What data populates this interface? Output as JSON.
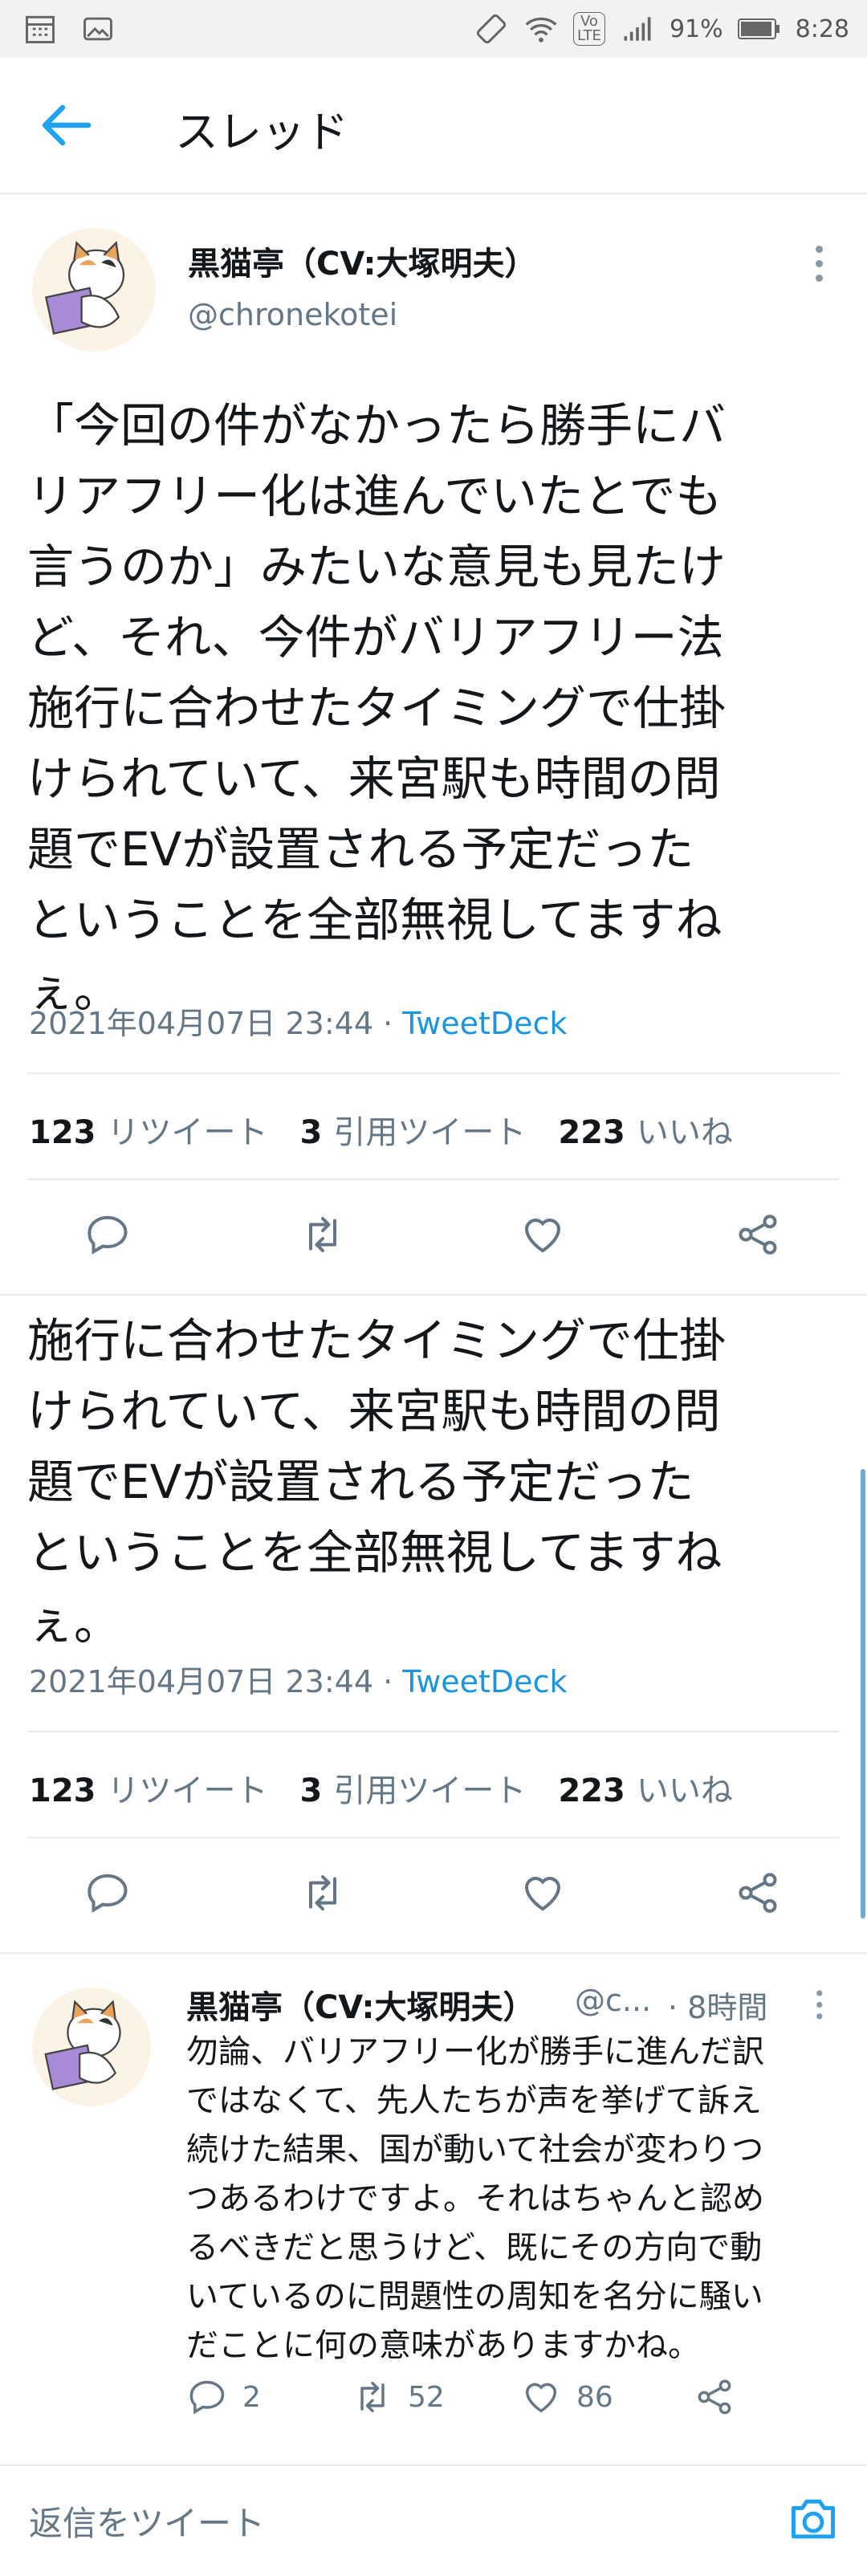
{
  "status_bar": {
    "battery": "91%",
    "time": "8:28",
    "lte": "LTE",
    "volte": "Vo"
  },
  "header": {
    "title": "スレッド"
  },
  "tweet": {
    "name": "黒猫亭（CV:大塚明夫）",
    "handle": "@chronekotei",
    "text": "「今回の件がなかったら勝手にバ\nリアフリー化は進んでいたとでも\n言うのか」みたいな意見も見たけ\nど、それ、今件がバリアフリー法\n施行に合わせたタイミングで仕掛\nけられていて、来宮駅も時間の問\n題でEVが設置される予定だった\nということを全部無視してますね\nぇ。",
    "date": "2021年04月07日 23:44",
    "separator": " · ",
    "client": "TweetDeck",
    "stats": [
      {
        "count": "123",
        "label": "リツイート"
      },
      {
        "count": "3",
        "label": "引用ツイート"
      },
      {
        "count": "223",
        "label": "いいね"
      }
    ]
  },
  "tweet_repeat": {
    "text": "施行に合わせたタイミングで仕掛\nけられていて、来宮駅も時間の問\n題でEVが設置される予定だった\nということを全部無視してますね\nぇ。",
    "date": "2021年04月07日 23:44",
    "separator": " · ",
    "client": "TweetDeck",
    "stats": [
      {
        "count": "123",
        "label": "リツイート"
      },
      {
        "count": "3",
        "label": "引用ツイート"
      },
      {
        "count": "223",
        "label": "いいね"
      }
    ]
  },
  "reply": {
    "name": "黒猫亭（CV:大塚明夫）",
    "handle": "@c...",
    "time": "· 8時間",
    "text": "勿論、バリアフリー化が勝手に進んだ訳\nではなくて、先人たちが声を挙げて訴え\n続けた結果、国が動いて社会が変わりつ\nつあるわけですよ。それはちゃんと認め\nるべきだと思うけど、既にその方向で動\nいているのに問題性の周知を名分に騒い\nだことに何の意味がありますかね。",
    "replies": "2",
    "retweets": "52",
    "likes": "86"
  },
  "compose": {
    "placeholder": "返信をツイート"
  },
  "colors": {
    "accent": "#1da1f2",
    "link": "#1b95e0",
    "muted": "#657786",
    "divider": "#e6ecf0"
  },
  "icons": [
    "calendar-icon",
    "image-icon",
    "rotate-icon",
    "wifi-icon",
    "volte-icon",
    "signal-icon",
    "battery-icon",
    "back-arrow-icon",
    "more-vertical-icon",
    "reply-icon",
    "retweet-icon",
    "like-icon",
    "share-icon",
    "camera-icon"
  ]
}
